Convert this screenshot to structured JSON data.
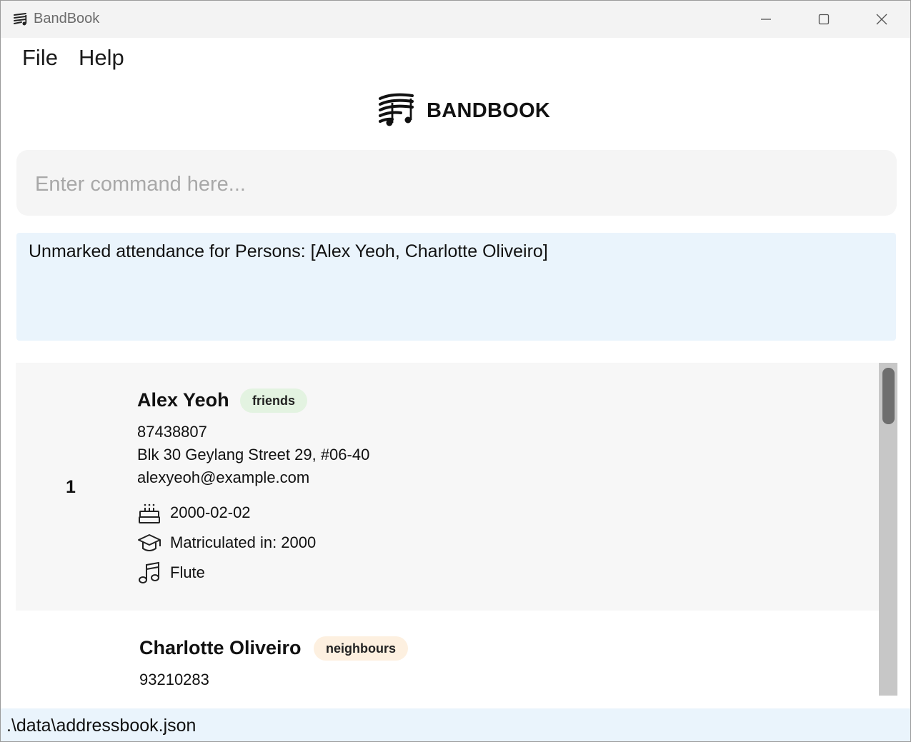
{
  "window": {
    "title": "BandBook"
  },
  "menu": {
    "file": "File",
    "help": "Help"
  },
  "logo": {
    "text": "BANDBOOK"
  },
  "command": {
    "placeholder": "Enter command here...",
    "value": ""
  },
  "result": {
    "message": "Unmarked attendance for Persons: [Alex Yeoh, Charlotte Oliveiro]"
  },
  "persons": [
    {
      "index": "1",
      "name": "Alex Yeoh",
      "tag": "friends",
      "phone": "87438807",
      "address": "Blk 30 Geylang Street 29, #06-40",
      "email": "alexyeoh@example.com",
      "birthday": "2000-02-02",
      "matriculation": "Matriculated in: 2000",
      "instrument": "Flute",
      "icons": [
        "birthday-cake-icon",
        "graduation-cap-icon",
        "music-note-icon"
      ]
    },
    {
      "name": "Charlotte Oliveiro",
      "tag": "neighbours",
      "phone": "93210283"
    }
  ],
  "status": {
    "path": ".\\data\\addressbook.json"
  },
  "colors": {
    "titlebar": "#f3f3f3",
    "command_bg": "#f5f5f5",
    "result_bg": "#eaf4fc",
    "tag_friends": "#e3f3e1",
    "tag_neighbours": "#fdf0e0",
    "card_selected": "#f7f7f7",
    "scrollbar_track": "#c7c7c7",
    "scrollbar_thumb": "#6e6e6e"
  }
}
